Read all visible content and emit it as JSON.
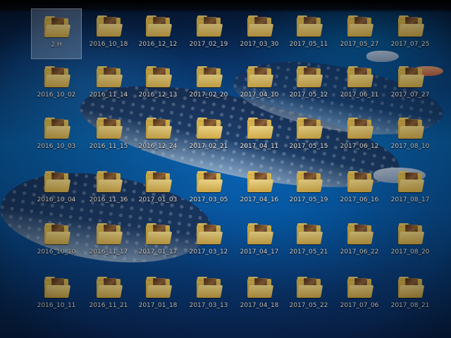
{
  "desktop": {
    "icons": [
      {
        "name": "2 H",
        "selected": true
      },
      {
        "name": "2016_10_18"
      },
      {
        "name": "2016_12_12"
      },
      {
        "name": "2017_02_19"
      },
      {
        "name": "2017_03_30"
      },
      {
        "name": "2017_05_11"
      },
      {
        "name": "2017_05_27"
      },
      {
        "name": "2017_07_25"
      },
      {
        "name": "2016_10_02"
      },
      {
        "name": "2016_11_14"
      },
      {
        "name": "2016_12_13"
      },
      {
        "name": "2017_02_20"
      },
      {
        "name": "2017_04_10"
      },
      {
        "name": "2017_05_12"
      },
      {
        "name": "2017_06_11"
      },
      {
        "name": "2017_07_27"
      },
      {
        "name": "2016_10_03"
      },
      {
        "name": "2016_11_15"
      },
      {
        "name": "2016_12_24"
      },
      {
        "name": "2017_02_21"
      },
      {
        "name": "2017_04_11"
      },
      {
        "name": "2017_05_15"
      },
      {
        "name": "2017_06_12"
      },
      {
        "name": "2017_08_10"
      },
      {
        "name": "2016_10_04"
      },
      {
        "name": "2016_11_16"
      },
      {
        "name": "2017_01_03"
      },
      {
        "name": "2017_03_05"
      },
      {
        "name": "2017_04_16"
      },
      {
        "name": "2017_05_19"
      },
      {
        "name": "2017_06_16"
      },
      {
        "name": "2017_08_17"
      },
      {
        "name": "2016_10_10"
      },
      {
        "name": "2016_11_17"
      },
      {
        "name": "2017_01_17"
      },
      {
        "name": "2017_03_12"
      },
      {
        "name": "2017_04_17"
      },
      {
        "name": "2017_05_21"
      },
      {
        "name": "2017_06_22"
      },
      {
        "name": "2017_08_20"
      },
      {
        "name": "2016_10_11"
      },
      {
        "name": "2016_11_21"
      },
      {
        "name": "2017_01_18"
      },
      {
        "name": "2017_03_13"
      },
      {
        "name": "2017_04_18"
      },
      {
        "name": "2017_05_22"
      },
      {
        "name": "2017_07_06"
      },
      {
        "name": "2017_08_21"
      }
    ]
  },
  "colors": {
    "label_text": "#ffffff",
    "selection": "#a0bee6",
    "folder_yellow": "#e9c85a"
  },
  "icon_semantics": {
    "folder_icon": "folder-icon"
  }
}
